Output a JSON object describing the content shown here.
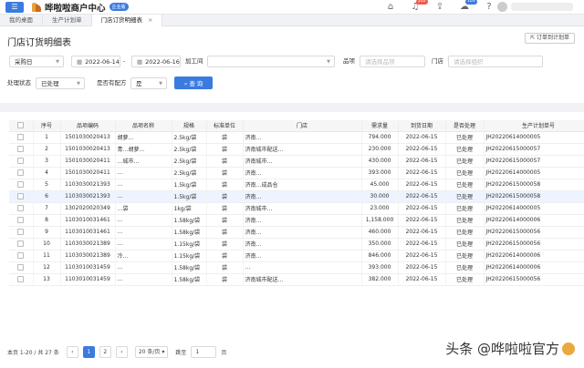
{
  "header": {
    "app_title": "哗啦啦商户中心",
    "badge": "企业版",
    "notifications": [
      {
        "icon": "bag-icon",
        "count": ""
      },
      {
        "icon": "bell-icon",
        "count": "202"
      },
      {
        "icon": "upload-icon",
        "count": ""
      },
      {
        "icon": "cloud-icon",
        "count": "103"
      },
      {
        "icon": "help-icon",
        "count": ""
      }
    ]
  },
  "tabs": [
    {
      "label": "我的桌面"
    },
    {
      "label": "生产计划单"
    },
    {
      "label": "门店订货明细表",
      "close": "×"
    }
  ],
  "page": {
    "title": "门店订货明细表",
    "download_label": "订单到计划单"
  },
  "filters": {
    "date_type": "采购日",
    "date_from": "2022-06-14",
    "date_sep": "-",
    "date_to": "2022-06-16",
    "workshop_label": "加工间",
    "item_label": "品项",
    "item_placeholder": "请选择品项",
    "store_label": "门店",
    "store_placeholder": "请选择组织",
    "status_label": "处理状态",
    "status_value": "已处理",
    "recipe_label": "是否有配方",
    "recipe_value": "是",
    "query_label": "查 询"
  },
  "table": {
    "columns": [
      "序号",
      "品项编码",
      "品项名称",
      "规格",
      "标准单位",
      "门店",
      "需求量",
      "到货日期",
      "是否处理",
      "生产计划单号"
    ],
    "rows": [
      {
        "no": "1",
        "code": "1501030020413",
        "name": "胡萝…",
        "spec": "2.5kg/袋",
        "unit": "袋",
        "store": "济南…",
        "qty": "794.000",
        "date": "2022-06-15",
        "status": "已处理",
        "plan": "JH20220614000005"
      },
      {
        "no": "2",
        "code": "1501030020413",
        "name": "青…胡萝…",
        "spec": "2.5kg/袋",
        "unit": "袋",
        "store": "济南城市配送…",
        "qty": "230.000",
        "date": "2022-06-15",
        "status": "已处理",
        "plan": "JH20220615000057"
      },
      {
        "no": "3",
        "code": "1501030020411",
        "name": "…城市…",
        "spec": "2.5kg/袋",
        "unit": "袋",
        "store": "济南城市…",
        "qty": "430.000",
        "date": "2022-06-15",
        "status": "已处理",
        "plan": "JH20220615000057"
      },
      {
        "no": "4",
        "code": "1501030020411",
        "name": "…",
        "spec": "2.5kg/袋",
        "unit": "袋",
        "store": "济南…",
        "qty": "393.000",
        "date": "2022-06-15",
        "status": "已处理",
        "plan": "JH20220614000005"
      },
      {
        "no": "5",
        "code": "1103030021393",
        "name": "…",
        "spec": "1.5kg/袋",
        "unit": "袋",
        "store": "济南…成品仓",
        "qty": "45.000",
        "date": "2022-06-15",
        "status": "已处理",
        "plan": "JH20220615000058"
      },
      {
        "no": "6",
        "code": "1103030021393",
        "name": "…",
        "spec": "1.5kg/袋",
        "unit": "袋",
        "store": "济南…",
        "qty": "30.000",
        "date": "2022-06-15",
        "status": "已处理",
        "plan": "JH20220615000058"
      },
      {
        "no": "7",
        "code": "1302020020349",
        "name": "…袋",
        "spec": "1kg/袋",
        "unit": "袋",
        "store": "济南城市…",
        "qty": "23.000",
        "date": "2022-06-15",
        "status": "已处理",
        "plan": "JH20220614000005"
      },
      {
        "no": "8",
        "code": "1103010031461",
        "name": "…",
        "spec": "1.58kg/袋",
        "unit": "袋",
        "store": "济南…",
        "qty": "1,158.000",
        "date": "2022-06-15",
        "status": "已处理",
        "plan": "JH20220614000006"
      },
      {
        "no": "9",
        "code": "1103010031461",
        "name": "…",
        "spec": "1.58kg/袋",
        "unit": "袋",
        "store": "济南…",
        "qty": "460.000",
        "date": "2022-06-15",
        "status": "已处理",
        "plan": "JH20220615000056"
      },
      {
        "no": "10",
        "code": "1103030021389",
        "name": "…",
        "spec": "1.15kg/袋",
        "unit": "袋",
        "store": "济南…",
        "qty": "350.000",
        "date": "2022-06-15",
        "status": "已处理",
        "plan": "JH20220615000056"
      },
      {
        "no": "11",
        "code": "1103030021389",
        "name": "冷…",
        "spec": "1.15kg/袋",
        "unit": "袋",
        "store": "济南…",
        "qty": "846.000",
        "date": "2022-06-15",
        "status": "已处理",
        "plan": "JH20220614000006"
      },
      {
        "no": "12",
        "code": "1103010031459",
        "name": "…",
        "spec": "1.58kg/袋",
        "unit": "袋",
        "store": "…",
        "qty": "393.000",
        "date": "2022-06-15",
        "status": "已处理",
        "plan": "JH20220614000006"
      },
      {
        "no": "13",
        "code": "1103010031459",
        "name": "…",
        "spec": "1.58kg/袋",
        "unit": "袋",
        "store": "济南城市配送…",
        "qty": "382.000",
        "date": "2022-06-15",
        "status": "已处理",
        "plan": "JH20220615000056"
      }
    ]
  },
  "pagination": {
    "summary": "本页 1-20 / 共 27 条",
    "prev": "‹",
    "pages": [
      "1",
      "2"
    ],
    "next": "›",
    "page_size": "20 条/页",
    "jump_label": "跳至",
    "jump_value": "1",
    "jump_suffix": "页"
  },
  "watermark": "头条 @哗啦啦官方"
}
